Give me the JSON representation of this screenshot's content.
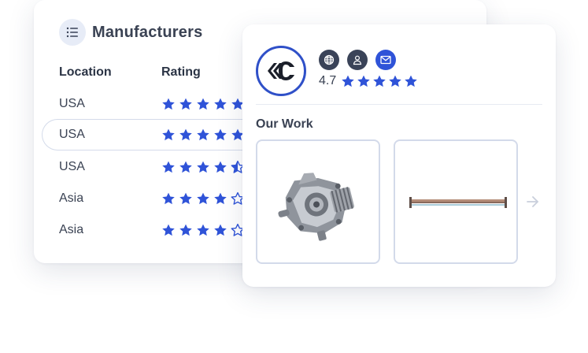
{
  "manufacturers": {
    "title": "Manufacturers",
    "columns": {
      "location": "Location",
      "rating": "Rating"
    },
    "rows": [
      {
        "location": "USA",
        "rating": 5
      },
      {
        "location": "USA",
        "rating": 5
      },
      {
        "location": "USA",
        "rating": 4.5
      },
      {
        "location": "Asia",
        "rating": 4
      },
      {
        "location": "Asia",
        "rating": 4
      }
    ]
  },
  "profile": {
    "rating_value": "4.7",
    "stars": 5,
    "section_title": "Our Work",
    "icons": [
      "globe-icon",
      "user-icon",
      "mail-icon"
    ]
  },
  "colors": {
    "star": "#2f53d8",
    "accent": "#2f50c8",
    "dark_icon_bg": "#3a4358"
  }
}
